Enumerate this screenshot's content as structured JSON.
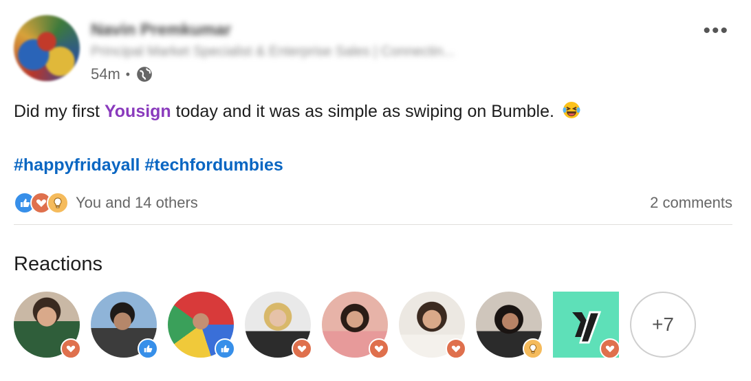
{
  "author": {
    "name": "Navin Premkumar",
    "headline": "Principal Market Specialist & Enterprise Sales | Connectin...",
    "time": "54m",
    "visibility_icon": "globe-icon"
  },
  "post": {
    "text_before": "Did my first ",
    "mention": "Yousign",
    "text_after": " today and it was as simple as swiping on Bumble.",
    "emoji": "laughing-crying-emoji",
    "hashtags": [
      "#happyfridayall",
      "#techfordumbies"
    ]
  },
  "social": {
    "reaction_types": [
      "like",
      "love",
      "insightful"
    ],
    "reactions_text": "You and 14 others",
    "comments_text": "2 comments"
  },
  "reactions_section": {
    "title": "Reactions",
    "reactors": [
      {
        "reaction": "love"
      },
      {
        "reaction": "like"
      },
      {
        "reaction": "like"
      },
      {
        "reaction": "love"
      },
      {
        "reaction": "love"
      },
      {
        "reaction": "love"
      },
      {
        "reaction": "insightful"
      },
      {
        "reaction": "love"
      }
    ],
    "more_count": "+7"
  },
  "colors": {
    "mention": "#8a3bbd",
    "hashtag": "#0a66c2",
    "like": "#378fe9",
    "love": "#df704d",
    "insightful": "#f5bb5c"
  }
}
